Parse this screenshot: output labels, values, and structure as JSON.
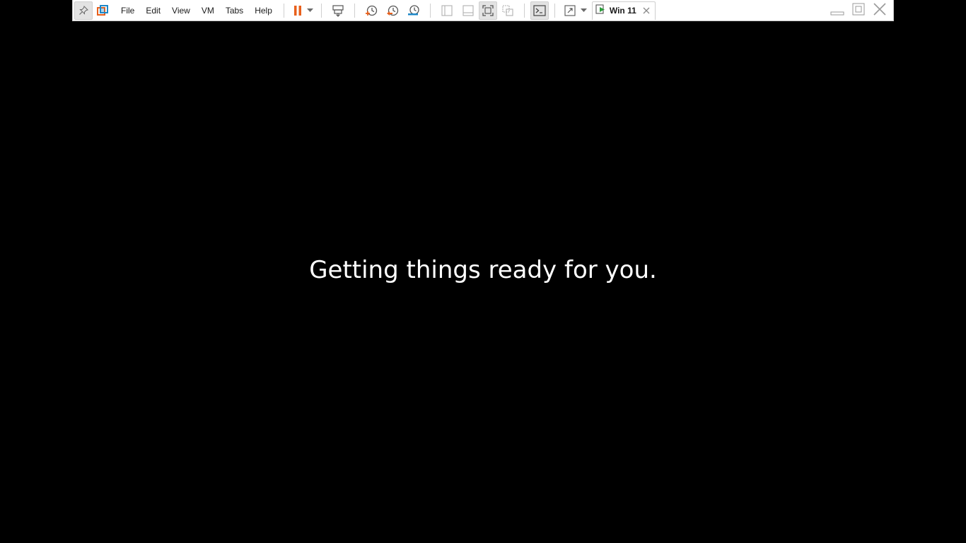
{
  "toolbar": {
    "menu": [
      {
        "label": "File"
      },
      {
        "label": "Edit"
      },
      {
        "label": "View"
      },
      {
        "label": "VM"
      },
      {
        "label": "Tabs"
      },
      {
        "label": "Help"
      }
    ],
    "icons": {
      "pin": "pin-icon",
      "logo": "vmware-logo-icon",
      "power": "pause-icon",
      "send_keys": "send-ctrl-alt-del-icon",
      "snapshot": "take-snapshot-icon",
      "revert": "revert-snapshot-icon",
      "manage": "snapshot-manager-icon",
      "console": "console-view-icon",
      "fullscreen": "full-screen-icon"
    },
    "colors": {
      "pause": "#e8601c",
      "snapshot_orange": "#e8601c",
      "snapshot_blue": "#1e88c8",
      "toolbar_bg": "#ffffff"
    }
  },
  "vm_tab": {
    "label": "Win 11"
  },
  "guest_screen": {
    "message": "Getting things ready for you.",
    "background": "#000000",
    "text_color": "#ffffff"
  }
}
